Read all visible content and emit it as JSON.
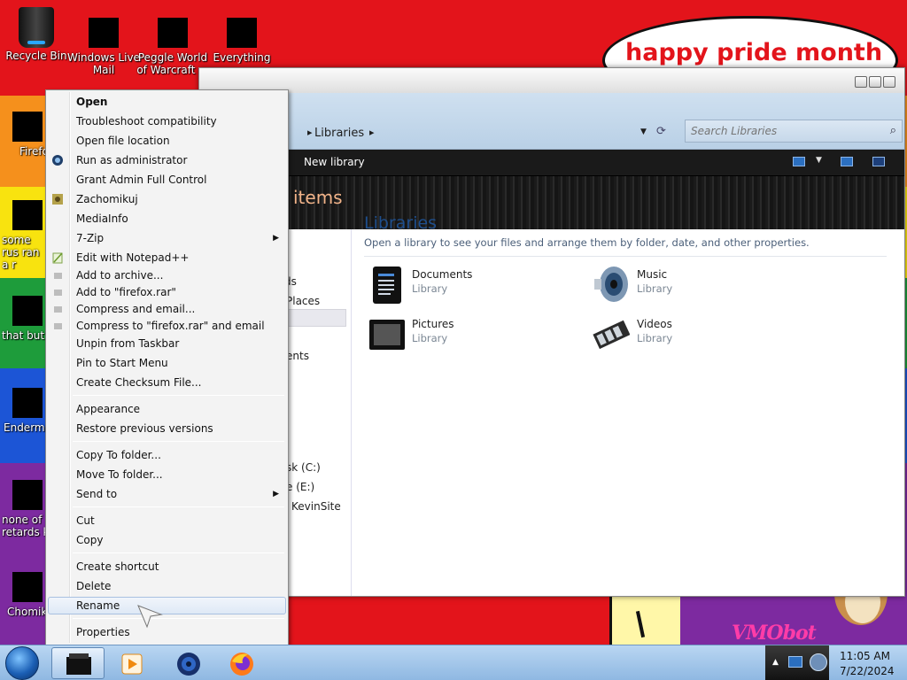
{
  "desktop": {
    "banner_text": "happy pride month",
    "watermark": "VMObot",
    "icons": [
      {
        "label": "Recycle Bin"
      },
      {
        "label": "Windows Live Mail"
      },
      {
        "label": "Peggle World of Warcraft ..."
      },
      {
        "label": "Everything"
      },
      {
        "label": "Firefo"
      },
      {
        "label": "some rus ran a r"
      },
      {
        "label": "that but"
      },
      {
        "label": "Enderma"
      },
      {
        "label": "none of retards k"
      },
      {
        "label": "Chomik"
      }
    ]
  },
  "explorer": {
    "address": "Libraries",
    "search_placeholder": "Search Libraries",
    "command_new_library": "New library",
    "header_title": "items",
    "nav_items": [
      "ds",
      "Places",
      "ents",
      "sk (C:)",
      "e (E:)",
      "KevinSite"
    ],
    "content_title": "Libraries",
    "content_subtitle": "Open a library to see your files and arrange them by folder, date, and other properties.",
    "libraries": [
      {
        "name": "Documents",
        "type": "Library",
        "icon": "documents-icon"
      },
      {
        "name": "Music",
        "type": "Library",
        "icon": "music-icon"
      },
      {
        "name": "Pictures",
        "type": "Library",
        "icon": "pictures-icon"
      },
      {
        "name": "Videos",
        "type": "Library",
        "icon": "videos-icon"
      }
    ]
  },
  "context_menu": {
    "items": [
      {
        "label": "Open",
        "bold": true
      },
      {
        "label": "Troubleshoot compatibility"
      },
      {
        "label": "Open file location"
      },
      {
        "label": "Run as administrator",
        "icon": "shield-icon"
      },
      {
        "label": "Grant Admin Full Control"
      },
      {
        "label": "Zachomikuj",
        "icon": "chomikuj-icon"
      },
      {
        "label": "MediaInfo"
      },
      {
        "label": "7-Zip",
        "submenu": true
      },
      {
        "label": "Edit with Notepad++",
        "icon": "notepad-icon"
      },
      {
        "label": "Add to archive...",
        "icon": "archive-icon"
      },
      {
        "label": "Add to \"firefox.rar\"",
        "icon": "archive-icon"
      },
      {
        "label": "Compress and email...",
        "icon": "archive-icon"
      },
      {
        "label": "Compress to \"firefox.rar\" and email",
        "icon": "archive-icon"
      },
      {
        "label": "Unpin from Taskbar"
      },
      {
        "label": "Pin to Start Menu"
      },
      {
        "label": "Create Checksum File..."
      },
      {
        "label": "Appearance"
      },
      {
        "label": "Restore previous versions"
      },
      {
        "label": "Copy To folder..."
      },
      {
        "label": "Move To folder..."
      },
      {
        "label": "Send to",
        "submenu": true
      },
      {
        "label": "Cut"
      },
      {
        "label": "Copy"
      },
      {
        "label": "Create shortcut"
      },
      {
        "label": "Delete"
      },
      {
        "label": "Rename",
        "highlighted": true
      },
      {
        "label": "Properties"
      }
    ]
  },
  "taskbar": {
    "time": "11:05 AM",
    "date": "7/22/2024"
  }
}
